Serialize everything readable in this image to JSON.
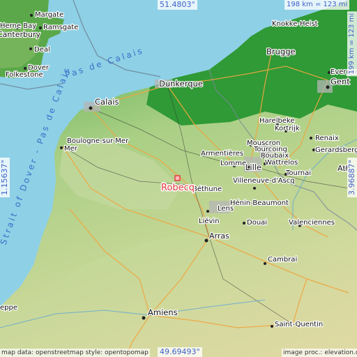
{
  "map": {
    "selected_place": "Robecq",
    "coordinates": {
      "north": "51.4803°",
      "south": "49.69493°",
      "west": "1.15637°",
      "east": "3.96887°"
    },
    "scale": {
      "horizontal": "198 km = 123 mi",
      "vertical": "199 km = 123 mi"
    },
    "attribution_left": "map data: openstreetmap  style: opentopomap",
    "attribution_right": "image proc.: elevation.city",
    "sea_label": "Pas de Calais",
    "strait_label": "Strait of Dover - Pas de Calais",
    "places": {
      "margate": "Margate",
      "ramsgate": "Ramsgate",
      "herne_bay": "Herne Bay",
      "canterbury": "Canterbury",
      "deal": "Deal",
      "dover": "Dover",
      "folkestone": "Folkestone",
      "knokke_heist": "Knokke-Heist",
      "brugge": "Brugge",
      "evergem": "Evergem",
      "gent": "Gent",
      "dunkerque": "Dunkerque",
      "calais": "Calais",
      "boulogne": "Boulogne-sur-Mer",
      "harelbeke": "Harelbeke",
      "kortrijk": "Kortrijk",
      "mouscron": "Mouscron",
      "tourcoing": "Tourcoing",
      "roubaix": "Roubaix",
      "wattrelos": "Wattrelos",
      "renaix": "Renaix",
      "geraardsbergen": "Gerardsbergen",
      "armentieres": "Armentières",
      "lomme": "Lomme",
      "lille": "Lille",
      "ath": "Ath",
      "tournai": "Tournai",
      "villeneuve": "Villeneuve-d'Ascq",
      "bethune": "Béthune",
      "lens": "Lens",
      "henin": "Hénin-Beaumont",
      "lievin": "Liévin",
      "douai": "Douai",
      "valenciennes": "Valenciennes",
      "arras": "Arras",
      "cambrai": "Cambrai",
      "amiens": "Amiens",
      "saint_quentin": "Saint-Quentin",
      "dieppe": "eppe"
    }
  }
}
